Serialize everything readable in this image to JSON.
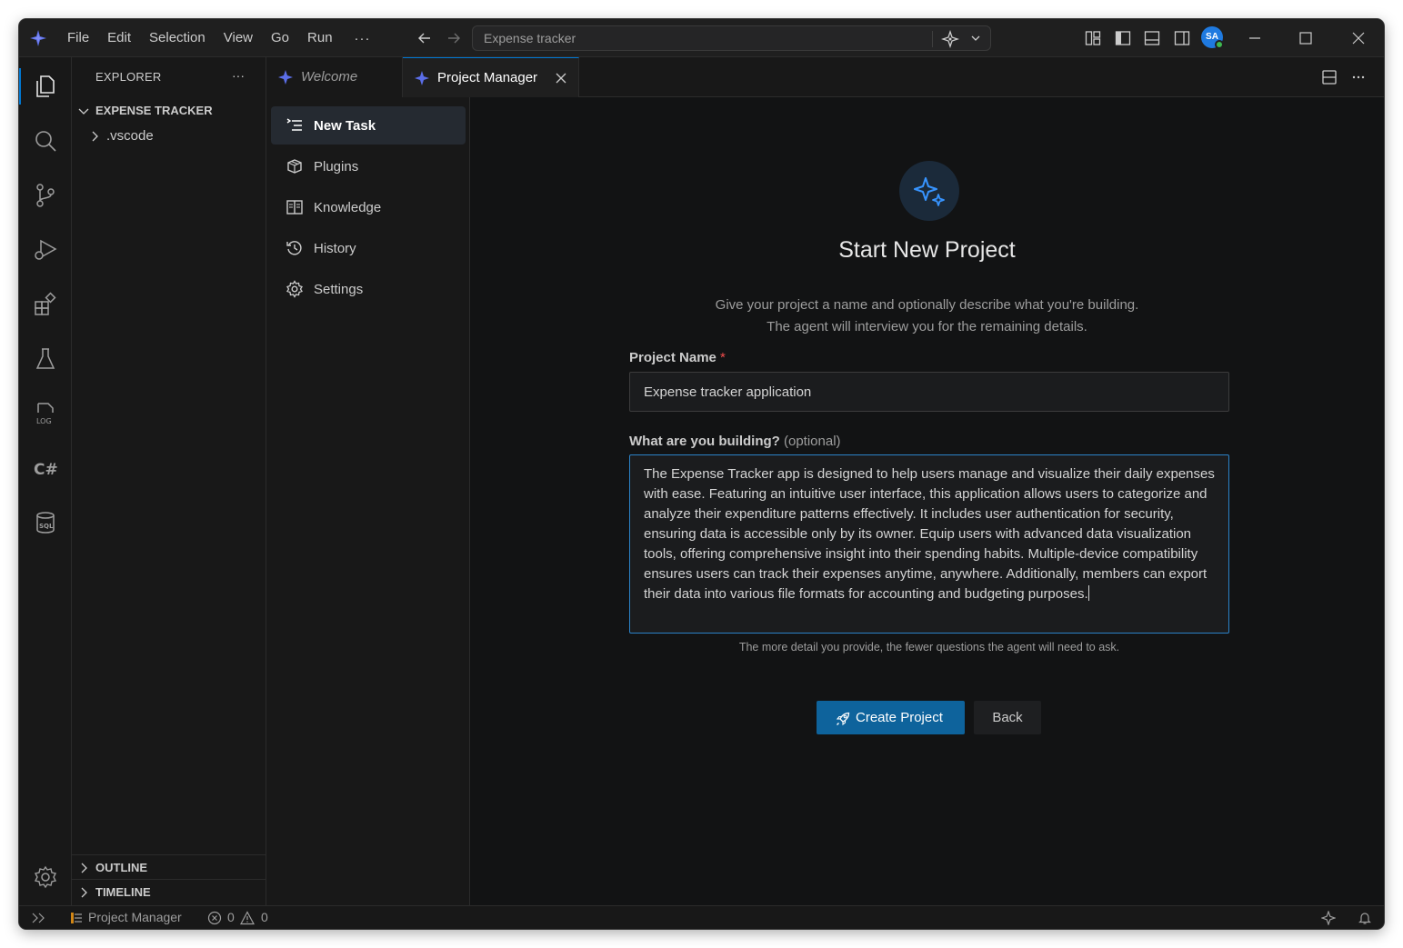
{
  "titlebar": {
    "menu": [
      "File",
      "Edit",
      "Selection",
      "View",
      "Go",
      "Run"
    ],
    "more": "···",
    "command_center_text": "Expense tracker",
    "avatar_initials": "SA"
  },
  "explorer": {
    "title": "EXPLORER",
    "more": "···",
    "folder_name": "EXPENSE TRACKER",
    "items": [
      ".vscode"
    ],
    "sections": [
      "OUTLINE",
      "TIMELINE"
    ]
  },
  "tabs": [
    {
      "label": "Welcome",
      "active": false
    },
    {
      "label": "Project Manager",
      "active": true
    }
  ],
  "nav": {
    "items": [
      {
        "label": "New Task",
        "icon": "new-task-icon",
        "active": true
      },
      {
        "label": "Plugins",
        "icon": "package-icon"
      },
      {
        "label": "Knowledge",
        "icon": "book-icon"
      },
      {
        "label": "History",
        "icon": "history-icon"
      },
      {
        "label": "Settings",
        "icon": "gear-icon"
      }
    ]
  },
  "form": {
    "heading": "Start New Project",
    "subtitle_line1": "Give your project a name and optionally describe what you're building.",
    "subtitle_line2": "The agent will interview you for the remaining details.",
    "name_label": "Project Name",
    "name_required_mark": "*",
    "name_value": "Expense tracker application",
    "desc_label": "What are you building?",
    "desc_optional": "(optional)",
    "desc_value": "The Expense Tracker app is designed to help users manage and visualize their daily expenses with ease. Featuring an intuitive user interface, this application allows users to categorize and analyze their expenditure patterns effectively. It includes user authentication for security, ensuring data is accessible only by its owner. Equip users with advanced data visualization tools, offering comprehensive insight into their spending habits. Multiple-device compatibility ensures users can track their expenses anytime, anywhere. Additionally, members can export their data into various file formats for accounting and budgeting purposes.",
    "hint": "The more detail you provide, the fewer questions the agent will need to ask.",
    "create_button": "Create Project",
    "back_button": "Back"
  },
  "statusbar": {
    "extension_label": "Project Manager",
    "errors": "0",
    "warnings": "0"
  },
  "colors": {
    "accent": "#0078d4",
    "primary_button": "#0e639c",
    "required": "#f14c4c",
    "avatar": "#1f7ae0"
  }
}
